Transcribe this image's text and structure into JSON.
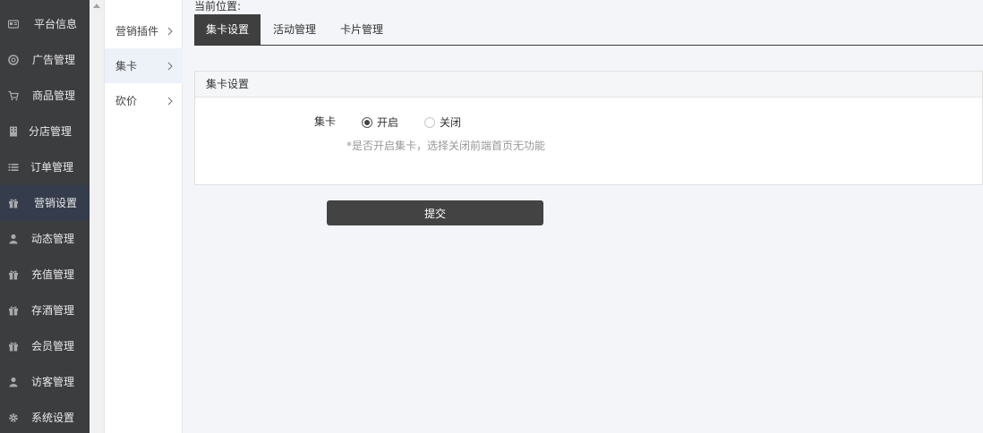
{
  "sidebar": {
    "items": [
      {
        "label": "平台信息",
        "icon": "id-card-icon"
      },
      {
        "label": "广告管理",
        "icon": "lifebuoy-icon"
      },
      {
        "label": "商品管理",
        "icon": "cart-icon"
      },
      {
        "label": "分店管理",
        "icon": "building-icon"
      },
      {
        "label": "订单管理",
        "icon": "list-icon"
      },
      {
        "label": "营销设置",
        "icon": "gift-icon",
        "active": true
      },
      {
        "label": "动态管理",
        "icon": "user-icon"
      },
      {
        "label": "充值管理",
        "icon": "gift-icon"
      },
      {
        "label": "存酒管理",
        "icon": "gift-icon"
      },
      {
        "label": "会员管理",
        "icon": "gift-icon"
      },
      {
        "label": "访客管理",
        "icon": "user-icon"
      },
      {
        "label": "系统设置",
        "icon": "gear-icon"
      }
    ]
  },
  "submenu": {
    "items": [
      {
        "label": "营销插件"
      },
      {
        "label": "集卡",
        "active": true
      },
      {
        "label": "砍价"
      }
    ]
  },
  "breadcrumb": {
    "label": "当前位置:"
  },
  "tabs": [
    {
      "label": "集卡设置",
      "active": true
    },
    {
      "label": "活动管理"
    },
    {
      "label": "卡片管理"
    }
  ],
  "panel": {
    "title": "集卡设置",
    "field_label": "集卡",
    "options": [
      {
        "label": "开启",
        "checked": true
      },
      {
        "label": "关闭",
        "checked": false
      }
    ],
    "hint": "*是否开启集卡，选择关闭前端首页无功能"
  },
  "submit_label": "提交",
  "colors": {
    "sidebar_bg": "#3c3d3f",
    "sidebar_active": "#353d4c",
    "tab_active": "#3f3f3f",
    "button": "#434343",
    "page_bg": "#f4f5f8"
  }
}
